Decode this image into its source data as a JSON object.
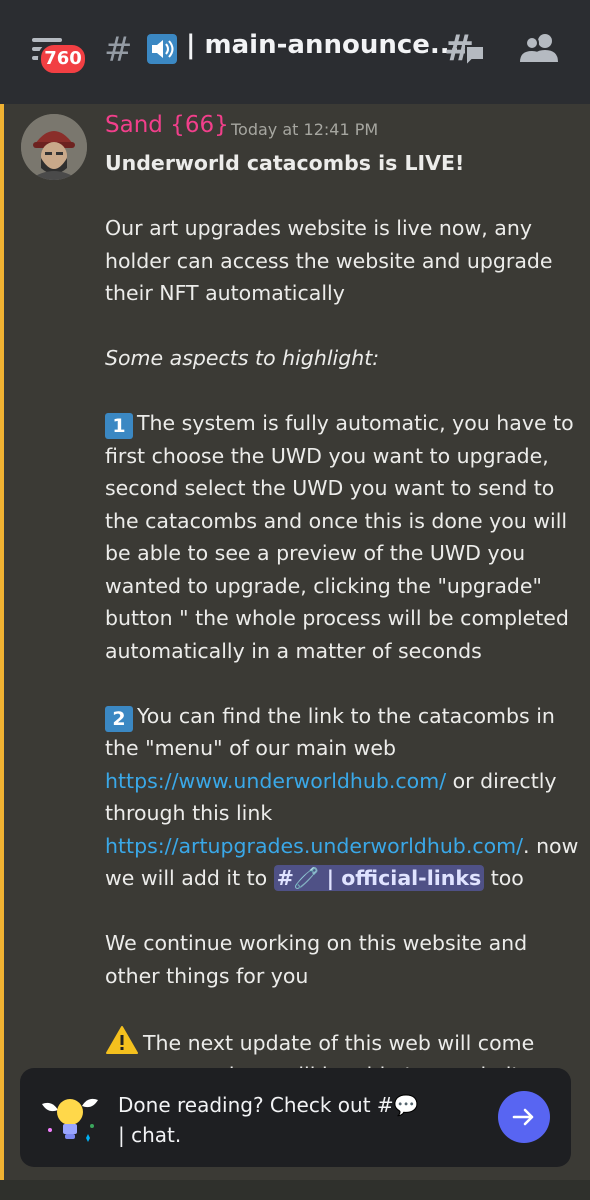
{
  "header": {
    "unread_count": "760",
    "hash": "#",
    "channel_name": "| main-announce..."
  },
  "message": {
    "author": "Sand {66}",
    "timestamp": "Today at 12:41 PM",
    "title": "Underworld catacombs is LIVE!",
    "para1": "Our art upgrades website is live now, any holder can access the website and upgrade their NFT automatically",
    "aspects_heading": "Some aspects to highlight:",
    "point1_number": "1",
    "point1_text": "The system is fully automatic, you have to first choose the UWD you want to upgrade, second select the UWD you want to send to the catacombs and once this is done you will be able to see a preview of the UWD you wanted to upgrade, clicking the \"upgrade\" button \" the whole process will be completed automatically in a matter of seconds",
    "point2_number": "2",
    "point2_text_a": "You can find the link to the catacombs in the \"menu\" of our main web",
    "link_main": "https://www.underworldhub.com/",
    "point2_text_b": "or directly through this link",
    "link_upgrades": "https://artupgrades.underworldhub.com/",
    "point2_text_c": ". now we will add it to",
    "channel_mention": "#🧷 | official-links",
    "point2_text_d": "too",
    "para_continue": "We continue working on this website and other things for you",
    "warning_text": "The next update of this web will come very soon where will be able to see, in its better..."
  },
  "prompt": {
    "text_prefix": "Done reading? Check out #💬",
    "text_suffix": "| chat."
  },
  "colors": {
    "accent": "#5865f2",
    "author": "#f23f8b",
    "link": "#3aa8e8",
    "highlight_bar": "#f0b232"
  }
}
